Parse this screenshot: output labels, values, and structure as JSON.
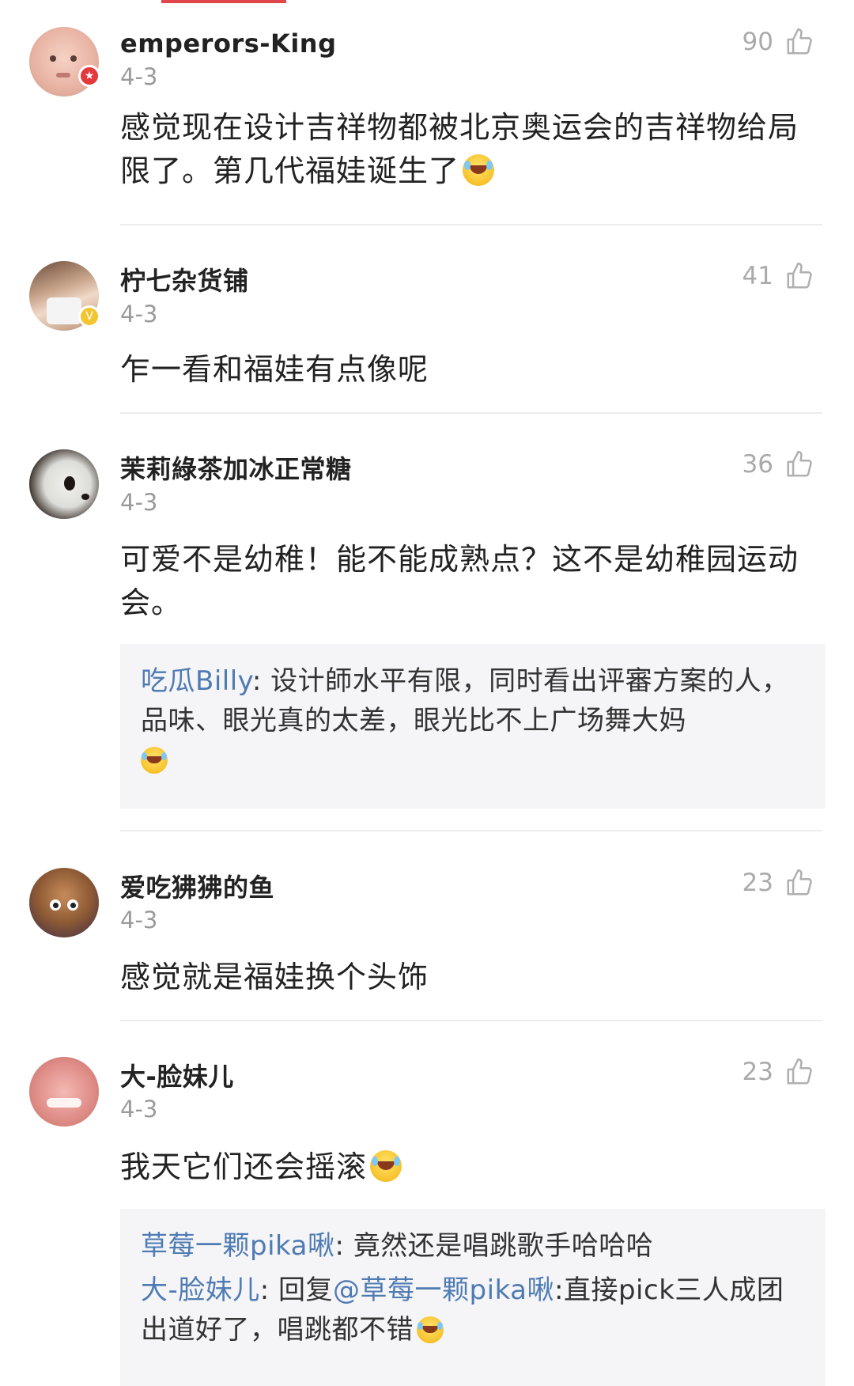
{
  "comments": [
    {
      "username": "emperors-King",
      "date": "4-3",
      "likes": "90",
      "text": "感觉现在设计吉祥物都被北京奥运会的吉祥物给局限了。第几代福娃诞生了",
      "badge": "red-star"
    },
    {
      "username": "柠七杂货铺",
      "date": "4-3",
      "likes": "41",
      "text": "乍一看和福娃有点像呢",
      "badge": "yellow-v"
    },
    {
      "username": "茉莉綠茶加冰正常糖",
      "date": "4-3",
      "likes": "36",
      "text": "可爱不是幼稚！能不能成熟点？这不是幼稚园运动会。",
      "replies": [
        {
          "name": "吃瓜Billy",
          "text": "设计師水平有限，同时看出评審方案的人，品味、眼光真的太差，眼光比不上广场舞大妈"
        }
      ]
    },
    {
      "username": "爱吃狒狒的鱼",
      "date": "4-3",
      "likes": "23",
      "text": "感觉就是福娃换个头饰"
    },
    {
      "username": "大-脸妹儿",
      "date": "4-3",
      "likes": "23",
      "text": "我天它们还会摇滚",
      "replies": [
        {
          "name": "草莓一颗pika啾",
          "text": "竟然还是唱跳歌手哈哈哈"
        },
        {
          "name": "大-脸妹儿",
          "prefix": "回复",
          "mention": "@草莓一颗pika啾",
          "text": ":直接pick三人成团出道好了，唱跳都不错"
        }
      ]
    }
  ],
  "reply_separator": ": ",
  "colors": {
    "tab_indicator": "#e0464b",
    "link": "#4f7bb3",
    "meta": "#9a9a9a",
    "reply_bg": "#f5f5f7"
  },
  "icons": [
    "thumbs-up-icon",
    "laughing-crying-emoji-icon",
    "star-badge-icon",
    "verified-badge-icon"
  ]
}
